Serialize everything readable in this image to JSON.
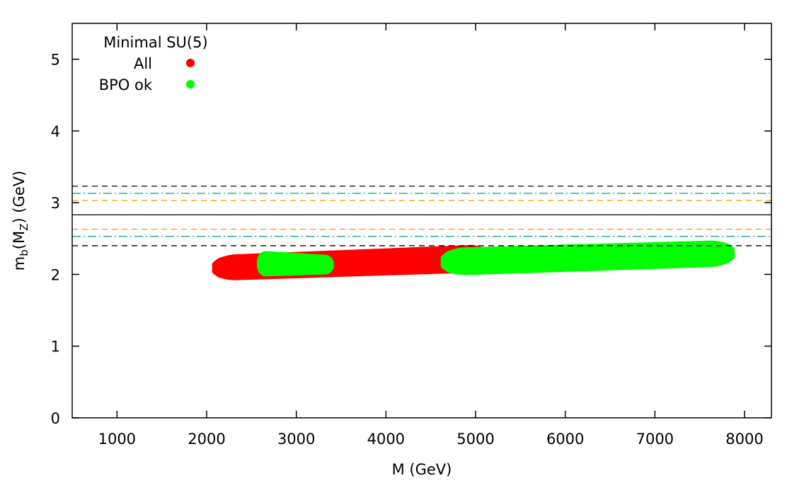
{
  "chart_data": {
    "type": "scatter",
    "title": "",
    "xlabel": "M (GeV)",
    "ylabel_main": "m",
    "ylabel_sub1": "b",
    "ylabel_mid": "(M",
    "ylabel_sub2": "Z",
    "ylabel_end": ") (GeV)",
    "xlim": [
      500,
      8300
    ],
    "ylim": [
      0,
      5.5
    ],
    "xticks": [
      1000,
      2000,
      3000,
      4000,
      5000,
      6000,
      7000,
      8000
    ],
    "yticks": [
      0,
      1,
      2,
      3,
      4,
      5
    ],
    "legend": {
      "title": "Minimal SU(5)",
      "placement": "top-left",
      "entries": [
        {
          "label": "All",
          "color": "#ff0000"
        },
        {
          "label": "BPO ok",
          "color": "#00ff00"
        }
      ]
    },
    "reference_lines": [
      {
        "y": 3.23,
        "style": "dashed",
        "color": "#000000"
      },
      {
        "y": 3.13,
        "style": "dash-dot",
        "color": "#009e73"
      },
      {
        "y": 3.03,
        "style": "dashed",
        "color": "#e69f00"
      },
      {
        "y": 2.83,
        "style": "solid",
        "color": "#000000"
      },
      {
        "y": 2.63,
        "style": "dashed",
        "color": "#e69f00"
      },
      {
        "y": 2.53,
        "style": "dash-dot",
        "color": "#009e73"
      },
      {
        "y": 2.4,
        "style": "dashed",
        "color": "#000000"
      }
    ],
    "series": [
      {
        "name": "All",
        "color": "#ff0000",
        "regions": [
          {
            "x": [
              2100,
              5150
            ],
            "y_low_start": 1.96,
            "y_low_end": 2.08,
            "y_high_start": 2.22,
            "y_high_end": 2.37
          }
        ]
      },
      {
        "name": "BPO ok",
        "color": "#00ff00",
        "regions": [
          {
            "x": [
              2600,
              3380
            ],
            "y_low_start": 2.02,
            "y_low_end": 2.05,
            "y_high_start": 2.28,
            "y_high_end": 2.22
          },
          {
            "x": [
              4650,
              7850
            ],
            "y_low_start": 2.03,
            "y_low_end": 2.16,
            "y_high_start": 2.32,
            "y_high_end": 2.43
          }
        ]
      }
    ]
  }
}
